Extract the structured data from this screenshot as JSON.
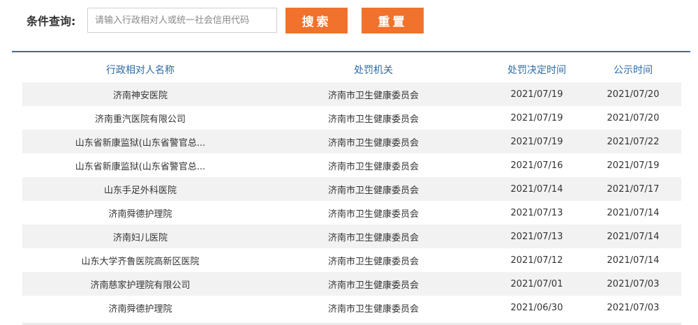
{
  "search": {
    "label": "条件查询:",
    "placeholder": "请输入行政相对人或统一社会信用代码",
    "value": "",
    "search_button": "搜索",
    "reset_button": "重置"
  },
  "table": {
    "headers": [
      "行政相对人名称",
      "处罚机关",
      "处罚决定时间",
      "公示时间"
    ],
    "rows": [
      [
        "济南神安医院",
        "济南市卫生健康委员会",
        "2021/07/19",
        "2021/07/20"
      ],
      [
        "济南重汽医院有限公司",
        "济南市卫生健康委员会",
        "2021/07/19",
        "2021/07/20"
      ],
      [
        "山东省新康监狱(山东省警官总...",
        "济南市卫生健康委员会",
        "2021/07/19",
        "2021/07/22"
      ],
      [
        "山东省新康监狱(山东省警官总...",
        "济南市卫生健康委员会",
        "2021/07/16",
        "2021/07/19"
      ],
      [
        "山东手足外科医院",
        "济南市卫生健康委员会",
        "2021/07/14",
        "2021/07/17"
      ],
      [
        "济南舜德护理院",
        "济南市卫生健康委员会",
        "2021/07/13",
        "2021/07/14"
      ],
      [
        "济南妇儿医院",
        "济南市卫生健康委员会",
        "2021/07/13",
        "2021/07/14"
      ],
      [
        "山东大学齐鲁医院高新区医院",
        "济南市卫生健康委员会",
        "2021/07/12",
        "2021/07/14"
      ],
      [
        "济南慈家护理院有限公司",
        "济南市卫生健康委员会",
        "2021/07/01",
        "2021/07/03"
      ],
      [
        "济南舜德护理院",
        "济南市卫生健康委员会",
        "2021/06/30",
        "2021/07/03"
      ]
    ]
  },
  "colors": {
    "accent": "#f0722d",
    "header_text": "#2e6aa4",
    "divider": "#3a6c9e",
    "row_alt": "#f2f2f2"
  }
}
